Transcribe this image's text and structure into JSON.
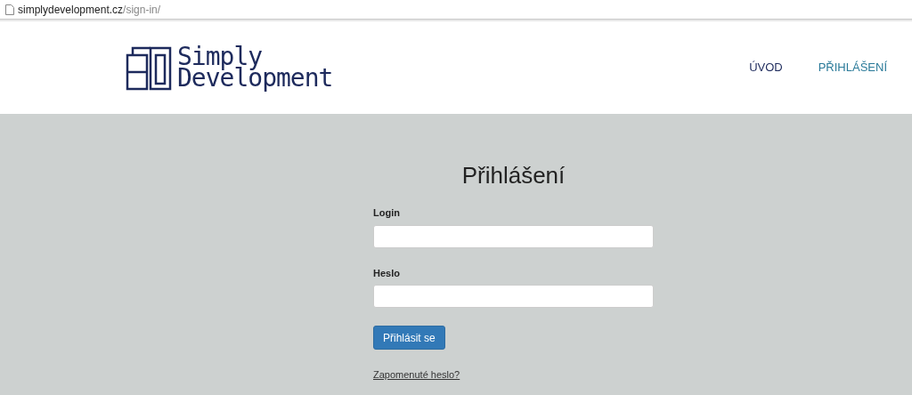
{
  "address_bar": {
    "host": "simplydevelopment.cz",
    "path": "/sign-in/"
  },
  "logo": {
    "line_1": "Simply",
    "line_2": "Development"
  },
  "nav": [
    {
      "label": "ÚVOD",
      "selected": false
    },
    {
      "label": "PŘIHLÁŠENÍ",
      "selected": true
    }
  ],
  "form": {
    "title": "Přihlášení",
    "fields": [
      {
        "label": "Login"
      },
      {
        "label": "Heslo"
      }
    ],
    "submit": "Přihlásit se",
    "forgot_link": "Zapomenuté heslo?"
  }
}
